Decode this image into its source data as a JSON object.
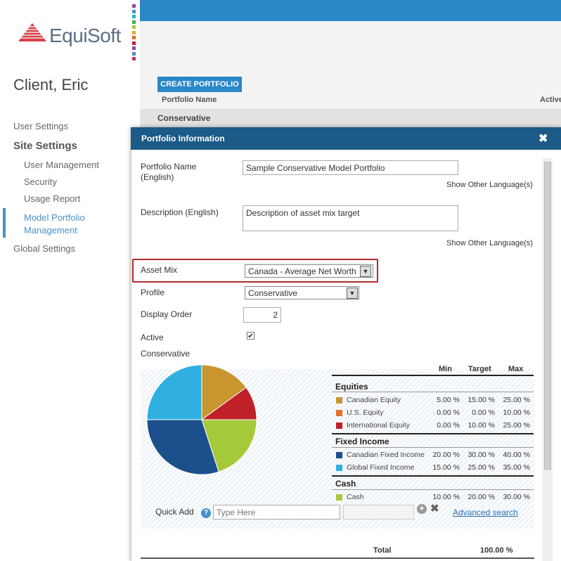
{
  "logo": {
    "text": "EquiSoft"
  },
  "sidebar": {
    "client_name": "Client, Eric",
    "items": {
      "user_settings": "User Settings",
      "site_settings": "Site Settings",
      "user_management": "User Management",
      "security": "Security",
      "usage_report": "Usage Report",
      "model_portfolio": "Model Portfolio Management",
      "global_settings": "Global Settings"
    }
  },
  "main": {
    "create_button": "CREATE PORTFOLIO",
    "col_portfolio_name": "Portfolio Name",
    "col_active": "Active",
    "row_name": "Conservative"
  },
  "dialog": {
    "title": "Portfolio Information",
    "close": "✖",
    "fields": {
      "name_label": "Portfolio Name",
      "name_sub": "(English)",
      "name_value": "Sample Conservative Model Portfolio",
      "show_other_lang": "Show Other Language(s)",
      "desc_label": "Description (English)",
      "desc_value": "Description of asset mix target",
      "asset_mix_label": "Asset Mix",
      "asset_mix_value": "Canada - Average Net Worth",
      "profile_label": "Profile",
      "profile_value": "Conservative",
      "display_order_label": "Display Order",
      "display_order_value": "2",
      "active_label": "Active",
      "active_checked": true,
      "section_label": "Conservative"
    },
    "table": {
      "headers": {
        "min": "Min",
        "target": "Target",
        "max": "Max"
      },
      "groups": [
        {
          "name": "Equities",
          "rows": [
            {
              "label": "Canadian Equity",
              "color": "#c8952f",
              "min": "5.00 %",
              "target": "15.00 %",
              "max": "25.00 %"
            },
            {
              "label": "U.S. Equity",
              "color": "#e3712b",
              "min": "0.00 %",
              "target": "0.00 %",
              "max": "10.00 %"
            },
            {
              "label": "International Equity",
              "color": "#c0202a",
              "min": "0.00 %",
              "target": "10.00 %",
              "max": "25.00 %"
            }
          ]
        },
        {
          "name": "Fixed Income",
          "rows": [
            {
              "label": "Canadian Fixed Income",
              "color": "#1a4f8b",
              "min": "20.00 %",
              "target": "30.00 %",
              "max": "40.00 %"
            },
            {
              "label": "Global Fixed Income",
              "color": "#2fb0e0",
              "min": "15.00 %",
              "target": "25.00 %",
              "max": "35.00 %"
            }
          ]
        },
        {
          "name": "Cash",
          "rows": [
            {
              "label": "Cash",
              "color": "#a6c93a",
              "min": "10.00 %",
              "target": "20.00 %",
              "max": "30.00 %"
            }
          ]
        }
      ],
      "total_label": "Total",
      "total_value": "100.00 %"
    },
    "quick_add": {
      "label": "Quick Add",
      "placeholder": "Type Here",
      "advanced": "Advanced search"
    }
  }
}
